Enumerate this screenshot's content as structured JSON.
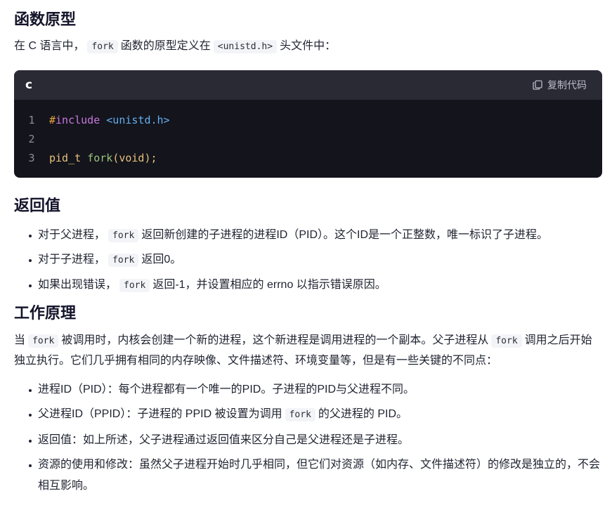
{
  "sections": {
    "proto": {
      "title": "函数原型",
      "intro_before": "在 C 语言中，",
      "intro_code1": "fork",
      "intro_mid": "函数的原型定义在",
      "intro_code2": "<unistd.h>",
      "intro_after": "头文件中："
    },
    "code": {
      "language": "c",
      "copy_label": "复制代码",
      "lines": [
        {
          "n": "1",
          "hash": "#",
          "pre": "include",
          "str": "<unistd.h>"
        },
        {
          "n": "2"
        },
        {
          "n": "3",
          "type": "pid_t",
          "fn": "fork",
          "punc": "(void);"
        }
      ]
    },
    "ret": {
      "title": "返回值",
      "items": [
        {
          "before": "对于父进程，",
          "code": "fork",
          "after": "返回新创建的子进程的进程ID（PID）。这个ID是一个正整数，唯一标识了子进程。"
        },
        {
          "before": "对于子进程，",
          "code": "fork",
          "after": "返回0。"
        },
        {
          "before": "如果出现错误，",
          "code": "fork",
          "after": "返回-1，并设置相应的 errno 以指示错误原因。"
        }
      ]
    },
    "how": {
      "title": "工作原理",
      "p_before": "当",
      "p_code1": "fork",
      "p_mid": "被调用时，内核会创建一个新的进程，这个新进程是调用进程的一个副本。父子进程从",
      "p_code2": "fork",
      "p_after": "调用之后开始独立执行。它们几乎拥有相同的内存映像、文件描述符、环境变量等，但是有一些关键的不同点：",
      "items": [
        {
          "text": "进程ID（PID）：每个进程都有一个唯一的PID。子进程的PID与父进程不同。"
        },
        {
          "before": "父进程ID（PPID）：子进程的 PPID 被设置为调用",
          "code": "fork",
          "after": "的父进程的 PID。"
        },
        {
          "text": "返回值：如上所述，父子进程通过返回值来区分自己是父进程还是子进程。"
        },
        {
          "text": "资源的使用和修改：虽然父子进程开始时几乎相同，但它们对资源（如内存、文件描述符）的修改是独立的，不会相互影响。"
        }
      ]
    }
  }
}
